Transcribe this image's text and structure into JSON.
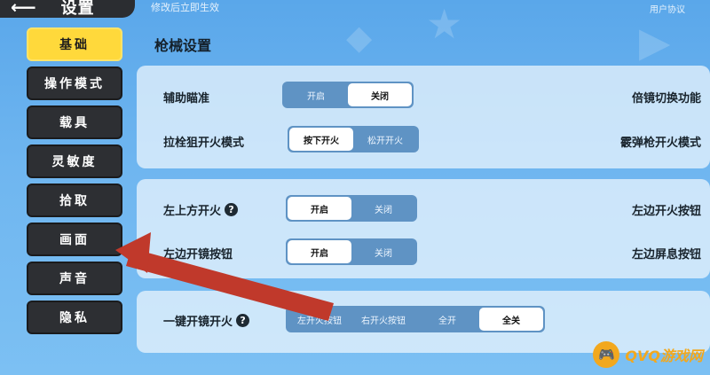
{
  "header": {
    "back_icon": "back-arrow-icon",
    "title": "设置",
    "hint": "修改后立即生效",
    "user_agreement": "用户协议"
  },
  "sidebar": {
    "items": [
      {
        "label": "基础",
        "active": true
      },
      {
        "label": "操作模式",
        "active": false
      },
      {
        "label": "载具",
        "active": false
      },
      {
        "label": "灵敏度",
        "active": false
      },
      {
        "label": "拾取",
        "active": false
      },
      {
        "label": "画面",
        "active": false
      },
      {
        "label": "声音",
        "active": false
      },
      {
        "label": "隐私",
        "active": false
      }
    ]
  },
  "main": {
    "section_title": "枪械设置",
    "cards": [
      {
        "rows": [
          {
            "label": "辅助瞄准",
            "options": [
              "开启",
              "关闭"
            ],
            "selected": 1,
            "right_label": "倍镜切换功能"
          },
          {
            "label": "拉栓狙开火模式",
            "options": [
              "按下开火",
              "松开开火"
            ],
            "selected": 0,
            "right_label": "霰弹枪开火模式"
          }
        ]
      },
      {
        "rows": [
          {
            "label": "左上方开火",
            "help": "?",
            "options": [
              "开启",
              "关闭"
            ],
            "selected": 0,
            "right_label": "左边开火按钮"
          },
          {
            "label": "左边开镜按钮",
            "options": [
              "开启",
              "关闭"
            ],
            "selected": 0,
            "right_label": "左边屏息按钮"
          }
        ]
      },
      {
        "rows": [
          {
            "label": "一键开镜开火",
            "help": "?",
            "options": [
              "左开火按钮",
              "右开火按钮",
              "全开",
              "全关"
            ],
            "selected": 3
          }
        ]
      }
    ]
  },
  "watermark": {
    "icon": "gamepad-icon",
    "text": "QVQ游戏网"
  },
  "colors": {
    "accent_yellow": "#ffd93b",
    "sidebar_dark": "#2d2f33",
    "arrow_red": "#c0392b",
    "toggle_blue": "#5f93c4"
  }
}
